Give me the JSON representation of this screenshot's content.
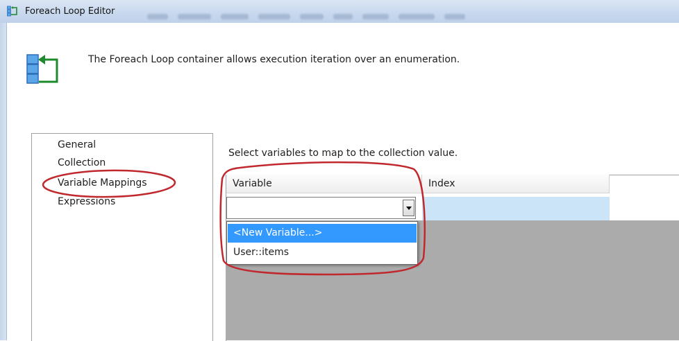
{
  "window": {
    "title": "Foreach Loop Editor",
    "title_icon": "foreach-loop-icon"
  },
  "header": {
    "icon": "foreach-loop-icon",
    "description": "The Foreach Loop container allows execution iteration over an enumeration."
  },
  "nav": {
    "items": [
      {
        "label": "General"
      },
      {
        "label": "Collection"
      },
      {
        "label": "Variable Mappings",
        "highlighted": true
      },
      {
        "label": "Expressions"
      }
    ]
  },
  "main": {
    "description": "Select variables to map to the collection value.",
    "grid": {
      "columns": [
        "Variable",
        "Index"
      ],
      "rows": [
        {
          "variable": "",
          "index": ""
        }
      ]
    },
    "combo": {
      "value": "",
      "icon": "chevron-down-icon",
      "options": [
        {
          "label": "<New Variable...>",
          "selected": true
        },
        {
          "label": "User::items",
          "selected": false
        }
      ]
    }
  },
  "colors": {
    "annotation_circle": "#c0282d",
    "selection_highlight": "#3399ff",
    "row_highlight": "#cce4f7",
    "titlebar": "#c9d9ee"
  }
}
